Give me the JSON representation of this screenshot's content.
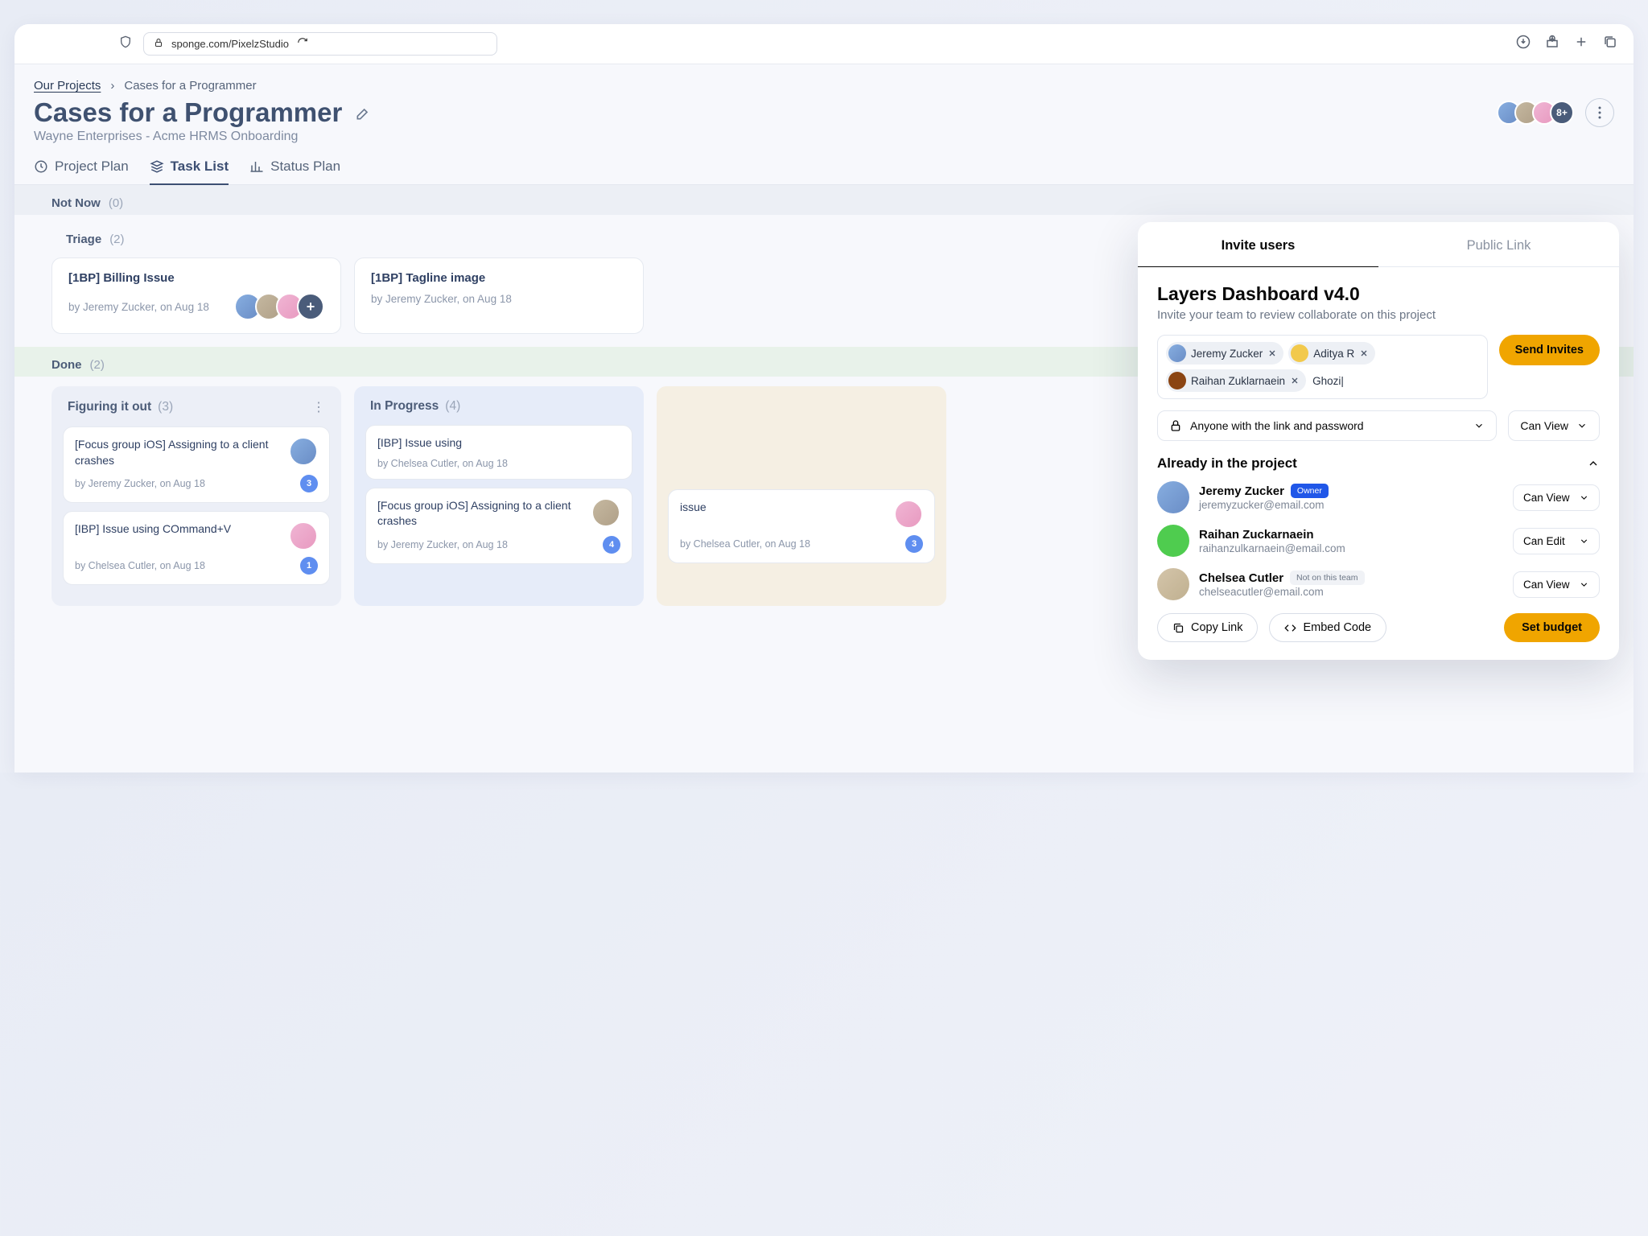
{
  "browser": {
    "url": "sponge.com/PixelzStudio"
  },
  "breadcrumb": {
    "root": "Our Projects",
    "current": "Cases for a Programmer"
  },
  "title": "Cases for a Programmer",
  "subtitle": "Wayne Enterprises - Acme HRMS Onboarding",
  "avatar_more": "8+",
  "tabs": {
    "plan": "Project Plan",
    "tasks": "Task List",
    "status": "Status Plan"
  },
  "sections": {
    "notnow": {
      "label": "Not Now",
      "count": "(0)"
    },
    "triage": {
      "label": "Triage",
      "count": "(2)"
    },
    "done": {
      "label": "Done",
      "count": "(2)"
    }
  },
  "triage_cards": [
    {
      "title": "[1BP] Billing Issue",
      "by": "by Jeremy Zucker, on Aug 18"
    },
    {
      "title": "[1BP] Tagline image",
      "by": "by Jeremy Zucker, on Aug 18"
    }
  ],
  "board": {
    "col1": {
      "title": "Figuring it out",
      "count": "(3)"
    },
    "col2": {
      "title": "In Progress",
      "count": "(4)"
    },
    "col3": {
      "title": "",
      "count": ""
    }
  },
  "cards": {
    "c1a": {
      "title": "[Focus group iOS] Assigning to a client crashes",
      "by": "by Jeremy Zucker, on Aug 18",
      "badge": "3"
    },
    "c1b": {
      "title": "[IBP] Issue using COmmand+V",
      "by": "by Chelsea Cutler, on Aug 18",
      "badge": "1"
    },
    "c2a": {
      "title": "[IBP] Issue using",
      "by": "by Chelsea Cutler, on Aug 18",
      "badge": ""
    },
    "c2b": {
      "title": "[Focus group iOS] Assigning to a client crashes",
      "by": "by Jeremy Zucker, on Aug 18",
      "badge": "4"
    },
    "c3a": {
      "title": "issue",
      "by": "by Chelsea Cutler, on Aug 18",
      "badge": "3"
    }
  },
  "modal": {
    "tab_invite": "Invite users",
    "tab_public": "Public Link",
    "title": "Layers Dashboard v4.0",
    "desc": "Invite your team to review collaborate on this project",
    "chips": {
      "a": "Jeremy Zucker",
      "b": "Aditya R",
      "c": "Raihan Zuklarnaein"
    },
    "typing": "Ghozi|",
    "send": "Send Invites",
    "access": "Anyone with the link and password",
    "canview": "Can View",
    "canedit": "Can Edit",
    "already": "Already in the project",
    "members": {
      "m1": {
        "name": "Jeremy Zucker",
        "email": "jeremyzucker@email.com",
        "tag": "Owner",
        "perm": "Can View"
      },
      "m2": {
        "name": "Raihan Zuckarnaein",
        "email": "raihanzulkarnaein@email.com",
        "perm": "Can Edit"
      },
      "m3": {
        "name": "Chelsea Cutler",
        "email": "chelseacutler@email.com",
        "tag": "Not on this team",
        "perm": "Can View"
      }
    },
    "copy": "Copy Link",
    "embed": "Embed Code",
    "budget": "Set budget"
  }
}
